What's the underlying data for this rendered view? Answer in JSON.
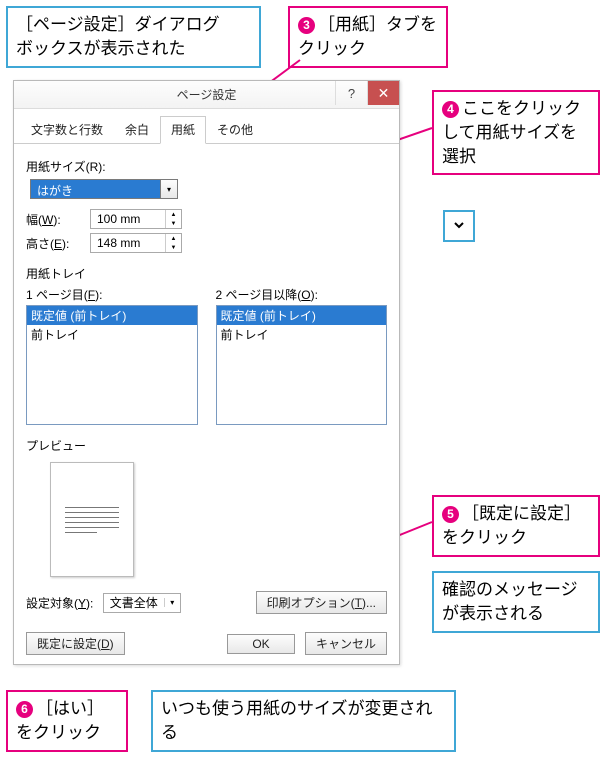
{
  "callouts": {
    "top_left": "［ページ設定］ダイアログ\nボックスが表示された",
    "c3_label": "［用紙］タブをクリック",
    "c4_label": "ここをクリックして用紙サイズを選択",
    "c5_label": "［既定に設定］をクリック",
    "confirm_msg": "確認のメッセージが表示される",
    "c6_label": "［はい］をクリック",
    "bottom_blue": "いつも使う用紙のサイズが変更される",
    "n3": "3",
    "n4": "4",
    "n5": "5",
    "n6": "6"
  },
  "dialog": {
    "title": "ページ設定",
    "help": "?",
    "close": "✕",
    "tabs": {
      "t1": "文字数と行数",
      "t2": "余白",
      "t3": "用紙",
      "t4": "その他"
    },
    "paper_size_label": "用紙サイズ(R):",
    "paper_size_value": "はがき",
    "width_label_pre": "幅(",
    "width_ak": "W",
    "width_label_post": "):",
    "width_value": "100 mm",
    "height_label_pre": "高さ(",
    "height_ak": "E",
    "height_label_post": "):",
    "height_value": "148 mm",
    "tray_label": "用紙トレイ",
    "tray_col1_pre": "1 ページ目(",
    "tray_col1_ak": "F",
    "tray_col1_post": "):",
    "tray_col2_pre": "2 ページ目以降(",
    "tray_col2_ak": "O",
    "tray_col2_post": "):",
    "tray_item1": "既定値 (前トレイ)",
    "tray_item2": "前トレイ",
    "preview_label": "プレビュー",
    "apply_to_label_pre": "設定対象(",
    "apply_to_ak": "Y",
    "apply_to_label_post": "):",
    "apply_to_value": "文書全体",
    "print_options_pre": "印刷オプション(",
    "print_options_ak": "T",
    "print_options_post": ")...",
    "default_btn_pre": "既定に設定(",
    "default_btn_ak": "D",
    "default_btn_post": ")",
    "ok": "OK",
    "cancel": "キャンセル"
  }
}
